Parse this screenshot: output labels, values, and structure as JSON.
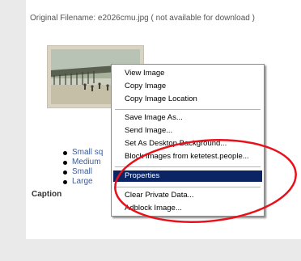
{
  "page": {
    "filename_text": "Original Filename: e2026cmu.jpg ( not available for download )",
    "thumbnail_icon": "pier-photo-thumbnail",
    "size_links": [
      "Small sq",
      "Medium",
      "Small",
      "Large"
    ],
    "caption_label": "Caption"
  },
  "context_menu": {
    "items": [
      {
        "label": "View Image"
      },
      {
        "label": "Copy Image"
      },
      {
        "label": "Copy Image Location"
      },
      {
        "label": "Save Image As..."
      },
      {
        "label": "Send Image..."
      },
      {
        "label": "Set As Desktop Background..."
      },
      {
        "label": "Block Images from ketetest.people..."
      },
      {
        "label": "Properties",
        "highlighted": true
      },
      {
        "label": "Clear Private Data..."
      },
      {
        "label": "Adblock Image..."
      }
    ],
    "highlight_color": "#0a2464"
  },
  "annotation": {
    "shape": "ellipse",
    "color": "#e8101a"
  }
}
